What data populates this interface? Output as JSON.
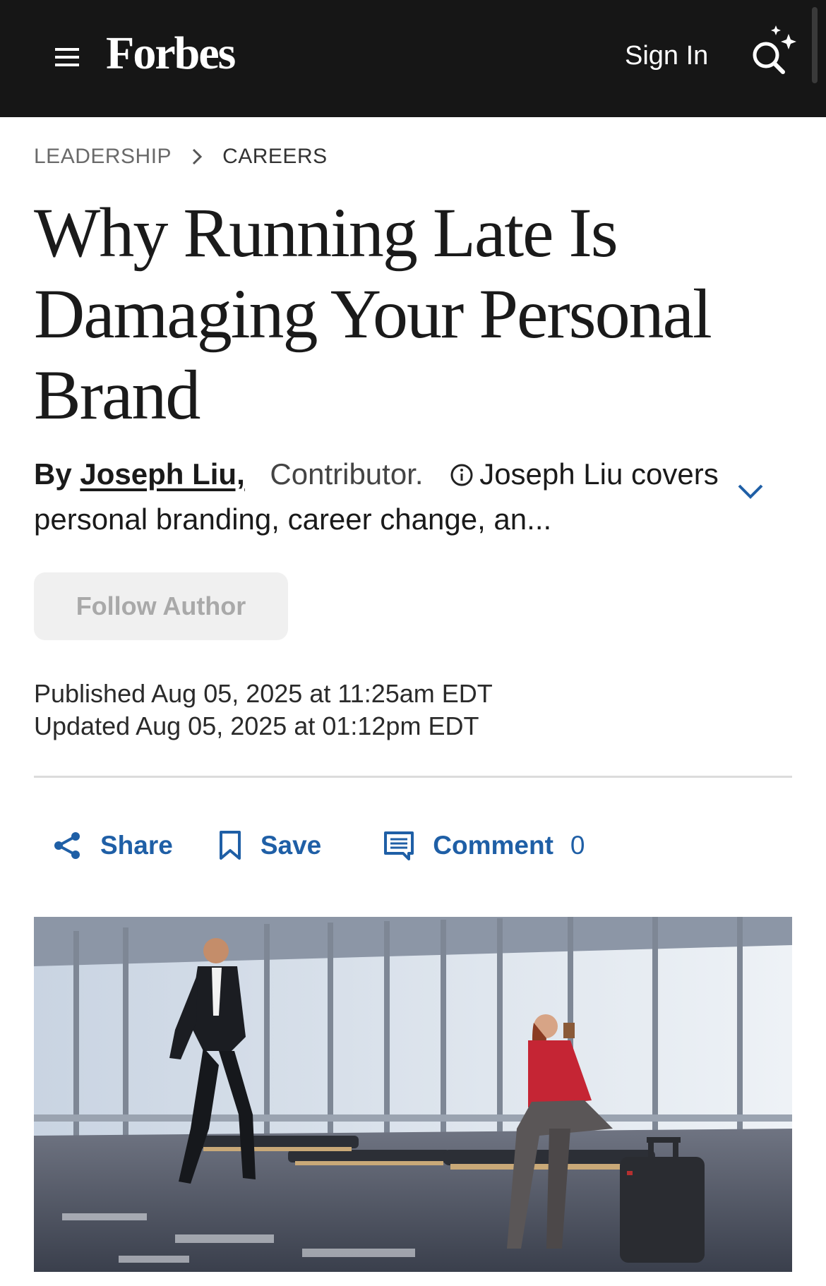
{
  "header": {
    "logo": "Forbes",
    "sign_in": "Sign In",
    "menu_icon": "hamburger-menu-icon",
    "search_icon": "search-sparkle-icon",
    "background": "#161616"
  },
  "breadcrumb": {
    "section": "LEADERSHIP",
    "subsection": "CAREERS"
  },
  "article": {
    "title": "Why Running Late Is Damaging Your Personal Brand",
    "byline_prefix": "By",
    "author": "Joseph Liu,",
    "role": "Contributor.",
    "bio_snippet": "Joseph Liu covers personal branding, career change, an...",
    "follow_label": "Follow Author",
    "published": "Published Aug 05, 2025 at 11:25am EDT",
    "updated": "Updated Aug 05, 2025 at 01:12pm EDT"
  },
  "actions": {
    "share_label": "Share",
    "save_label": "Save",
    "comment_label": "Comment",
    "comment_count": "0",
    "accent_color": "#1f5fa6"
  }
}
